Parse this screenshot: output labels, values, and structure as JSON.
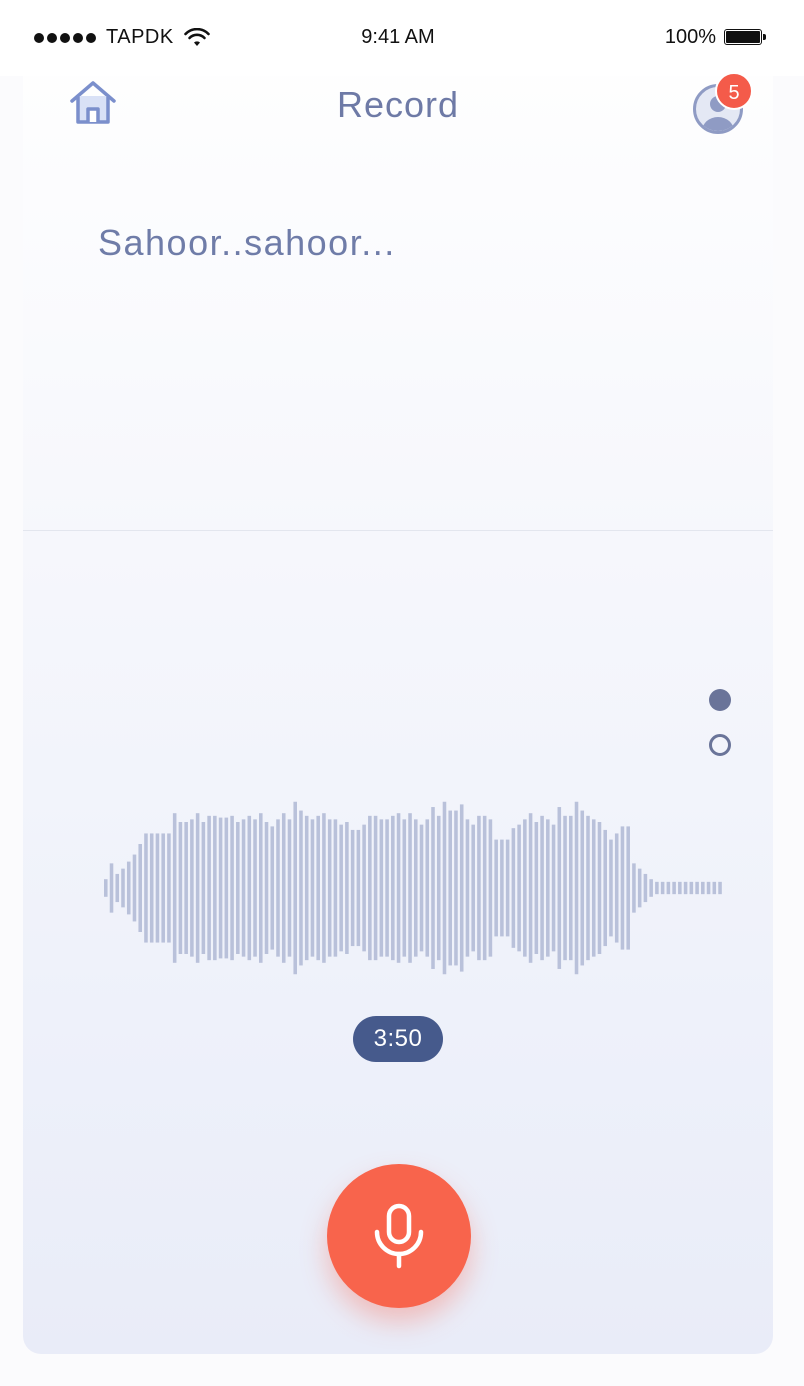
{
  "status_bar": {
    "carrier": "TAPDK",
    "time": "9:41 AM",
    "battery": "100%"
  },
  "nav": {
    "title": "Record",
    "home_icon": "home-icon",
    "profile_icon": "user-avatar-icon",
    "notification_count": "5"
  },
  "transcript": {
    "text": "Sahoor..sahoor..."
  },
  "pager": {
    "page_count": 2,
    "active_index": 0
  },
  "recording": {
    "timer": "3:50",
    "mic_icon": "microphone-icon"
  },
  "waveform": {
    "amplitudes": [
      0.1,
      0.28,
      0.16,
      0.22,
      0.3,
      0.38,
      0.5,
      0.62,
      0.62,
      0.62,
      0.62,
      0.62,
      0.85,
      0.75,
      0.75,
      0.78,
      0.85,
      0.75,
      0.82,
      0.82,
      0.8,
      0.8,
      0.82,
      0.75,
      0.78,
      0.82,
      0.78,
      0.85,
      0.75,
      0.7,
      0.78,
      0.85,
      0.78,
      0.98,
      0.88,
      0.82,
      0.78,
      0.82,
      0.85,
      0.78,
      0.78,
      0.72,
      0.75,
      0.66,
      0.66,
      0.72,
      0.82,
      0.82,
      0.78,
      0.78,
      0.82,
      0.85,
      0.78,
      0.85,
      0.78,
      0.72,
      0.78,
      0.92,
      0.82,
      0.98,
      0.88,
      0.88,
      0.95,
      0.78,
      0.72,
      0.82,
      0.82,
      0.78,
      0.55,
      0.55,
      0.55,
      0.68,
      0.72,
      0.78,
      0.85,
      0.75,
      0.82,
      0.78,
      0.72,
      0.92,
      0.82,
      0.82,
      0.98,
      0.88,
      0.82,
      0.78,
      0.75,
      0.66,
      0.55,
      0.62,
      0.7,
      0.7,
      0.28,
      0.22,
      0.16,
      0.1,
      0.07,
      0.07,
      0.07,
      0.07,
      0.07,
      0.07,
      0.07,
      0.07,
      0.07,
      0.07,
      0.07,
      0.07
    ],
    "color": "#b9c1da"
  },
  "colors": {
    "accent": "#f8644c",
    "title": "#6e7aa6",
    "timer_bg": "#465a8c",
    "badge": "#f45b4a"
  }
}
